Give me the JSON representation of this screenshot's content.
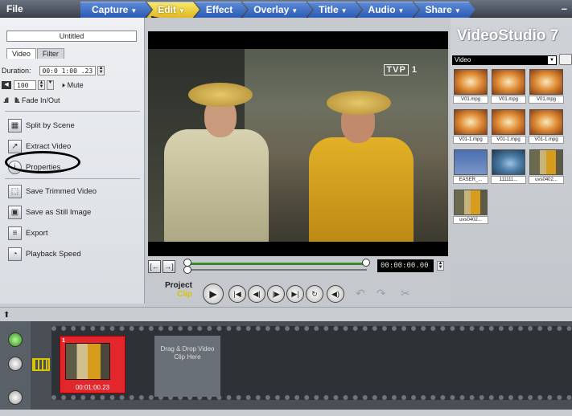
{
  "menu": {
    "file": "File",
    "tabs": [
      {
        "label": "Capture",
        "arrow": "▼"
      },
      {
        "label": "Edit",
        "arrow": "▼"
      },
      {
        "label": "Effect",
        "arrow": ""
      },
      {
        "label": "Overlay",
        "arrow": "▼"
      },
      {
        "label": "Title",
        "arrow": "▼"
      },
      {
        "label": "Audio",
        "arrow": "▼"
      },
      {
        "label": "Share",
        "arrow": "▼"
      }
    ],
    "minimize": "–"
  },
  "options": {
    "title": "Untitled",
    "tab_video": "Video",
    "tab_filter": "Filter",
    "duration_label": "Duration:",
    "duration_value": "00:0 1:00 .23",
    "volume": "100",
    "mute": "Mute",
    "fade": "Fade In/Out",
    "split_by_scene": "Split by Scene",
    "extract_video": "Extract Video",
    "properties": "Properties",
    "save_trimmed": "Save Trimmed Video",
    "save_still": "Save as Still Image",
    "export": "Export",
    "playback_speed": "Playback Speed"
  },
  "preview": {
    "channel_logo": "TVP",
    "channel_num": "1",
    "timecode": "00:00:00.00",
    "project_label": "Project",
    "clip_label": "Clip"
  },
  "library": {
    "brand": "VideoStudio 7",
    "category": "Video",
    "thumbs": [
      {
        "caption": "V01.mpg",
        "style": "orange"
      },
      {
        "caption": "V01.mpg",
        "style": "orange"
      },
      {
        "caption": "V01.mpg",
        "style": "orange"
      },
      {
        "caption": "V01-1.mpg",
        "style": "orange"
      },
      {
        "caption": "V01-1.mpg",
        "style": "orange"
      },
      {
        "caption": "V01-1.mpg",
        "style": "orange"
      },
      {
        "caption": "EASER_...",
        "style": "blue"
      },
      {
        "caption": "111111...",
        "style": "car"
      },
      {
        "caption": "uvs0402...",
        "style": "people"
      },
      {
        "caption": "uvs0402...",
        "style": "people"
      }
    ]
  },
  "timeline": {
    "clip_number": "1",
    "clip_time": "00:01:00.23",
    "drop_text": "Drag & Drop Video Clip Here"
  }
}
